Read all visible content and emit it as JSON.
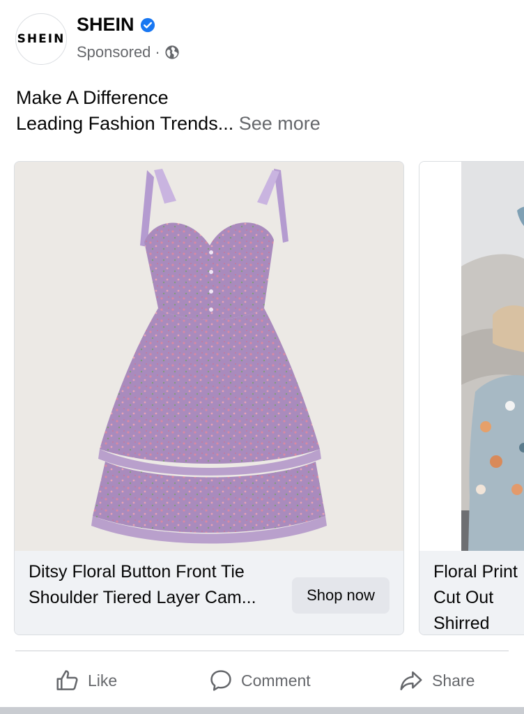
{
  "post": {
    "page_name": "SHEIN",
    "avatar_text": "SHEIN",
    "sponsored_label": "Sponsored",
    "meta_separator": "·",
    "caption_line1": "Make A Difference",
    "caption_line2": "Leading Fashion Trends...",
    "see_more_label": "See more"
  },
  "carousel": {
    "cards": [
      {
        "title": "Ditsy Floral Button Front Tie Shoulder Tiered Layer Cam...",
        "button_label": "Shop now",
        "image_icon": "lavender-floral-dress-image"
      },
      {
        "title": "Floral Print Cut Out Shirred",
        "title_visible": "Floral Print\nOut Shirred",
        "image_icon": "floral-print-dress-model-image"
      }
    ]
  },
  "actions": {
    "like_label": "Like",
    "comment_label": "Comment",
    "share_label": "Share"
  },
  "icons": {
    "verified": "verified-badge-icon",
    "globe": "globe-icon",
    "like": "thumbs-up-icon",
    "comment": "speech-bubble-icon",
    "share": "share-arrow-icon"
  },
  "colors": {
    "accent_blue": "#1877f2",
    "secondary_text": "#65676b",
    "card_footer_bg": "#f0f2f5",
    "button_bg": "#e4e6eb",
    "dress_color": "#a98bbd"
  }
}
